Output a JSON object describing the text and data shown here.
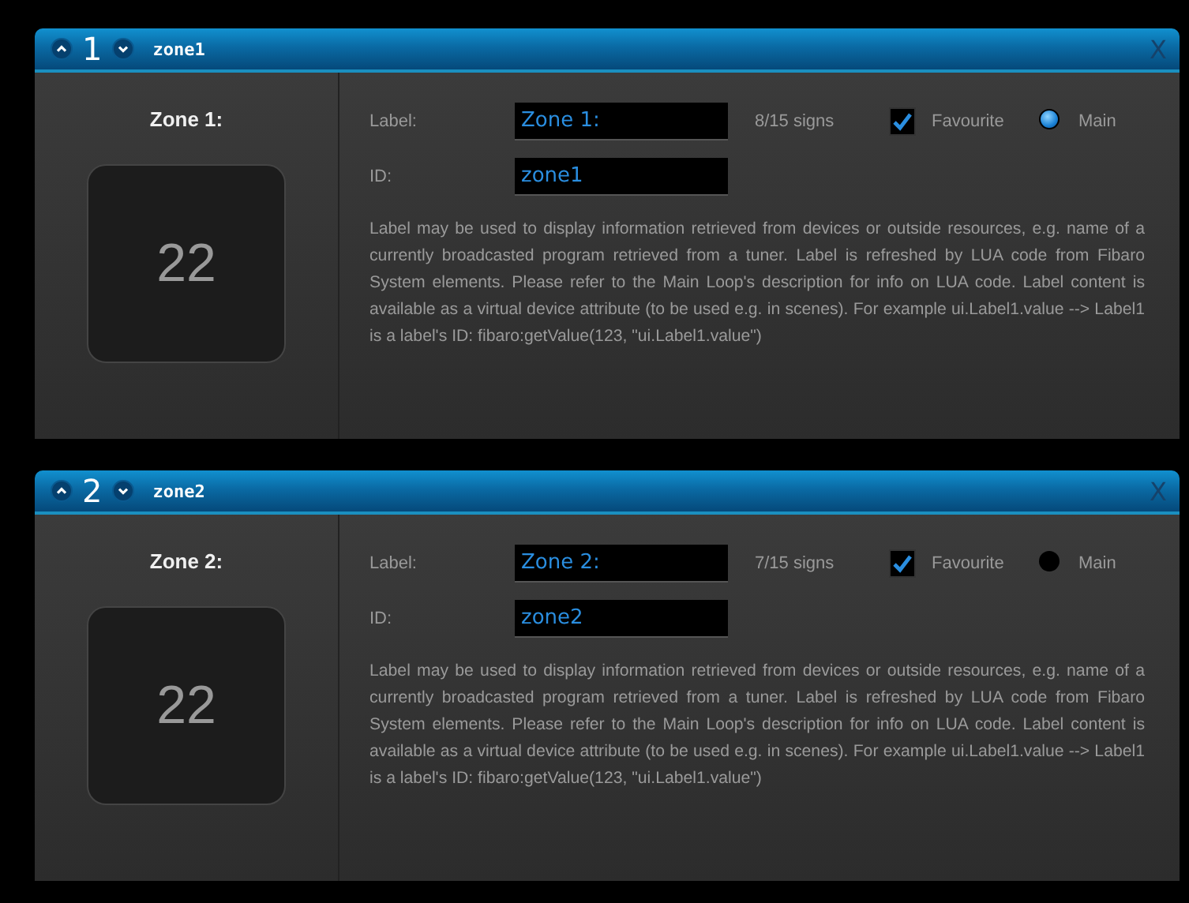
{
  "zones": [
    {
      "number": "1",
      "name": "zone1",
      "close": "X",
      "title": "Zone 1:",
      "value": "22",
      "label_caption": "Label:",
      "label_value": "Zone 1:",
      "signs": "8/15 signs",
      "favourite": {
        "label": "Favourite",
        "checked": true
      },
      "main": {
        "label": "Main",
        "selected": true
      },
      "id_caption": "ID:",
      "id_value": "zone1",
      "description": "Label may be used to display information retrieved from devices or outside resources, e.g. name of a currently broadcasted program retrieved from a tuner. Label is refreshed by LUA code from Fibaro System elements. Please refer to the Main Loop's description for info on LUA code. Label content is available as a virtual device attribute (to be used e.g. in scenes). For example ui.Label1.value --> Label1 is a label's ID: fibaro:getValue(123, \"ui.Label1.value\")"
    },
    {
      "number": "2",
      "name": "zone2",
      "close": "X",
      "title": "Zone 2:",
      "value": "22",
      "label_caption": "Label:",
      "label_value": "Zone 2:",
      "signs": "7/15 signs",
      "favourite": {
        "label": "Favourite",
        "checked": true
      },
      "main": {
        "label": "Main",
        "selected": false
      },
      "id_caption": "ID:",
      "id_value": "zone2",
      "description": "Label may be used to display information retrieved from devices or outside resources, e.g. name of a currently broadcasted program retrieved from a tuner. Label is refreshed by LUA code from Fibaro System elements. Please refer to the Main Loop's description for info on LUA code. Label content is available as a virtual device attribute (to be used e.g. in scenes). For example ui.Label1.value --> Label1 is a label's ID: fibaro:getValue(123, \"ui.Label1.value\")"
    }
  ]
}
